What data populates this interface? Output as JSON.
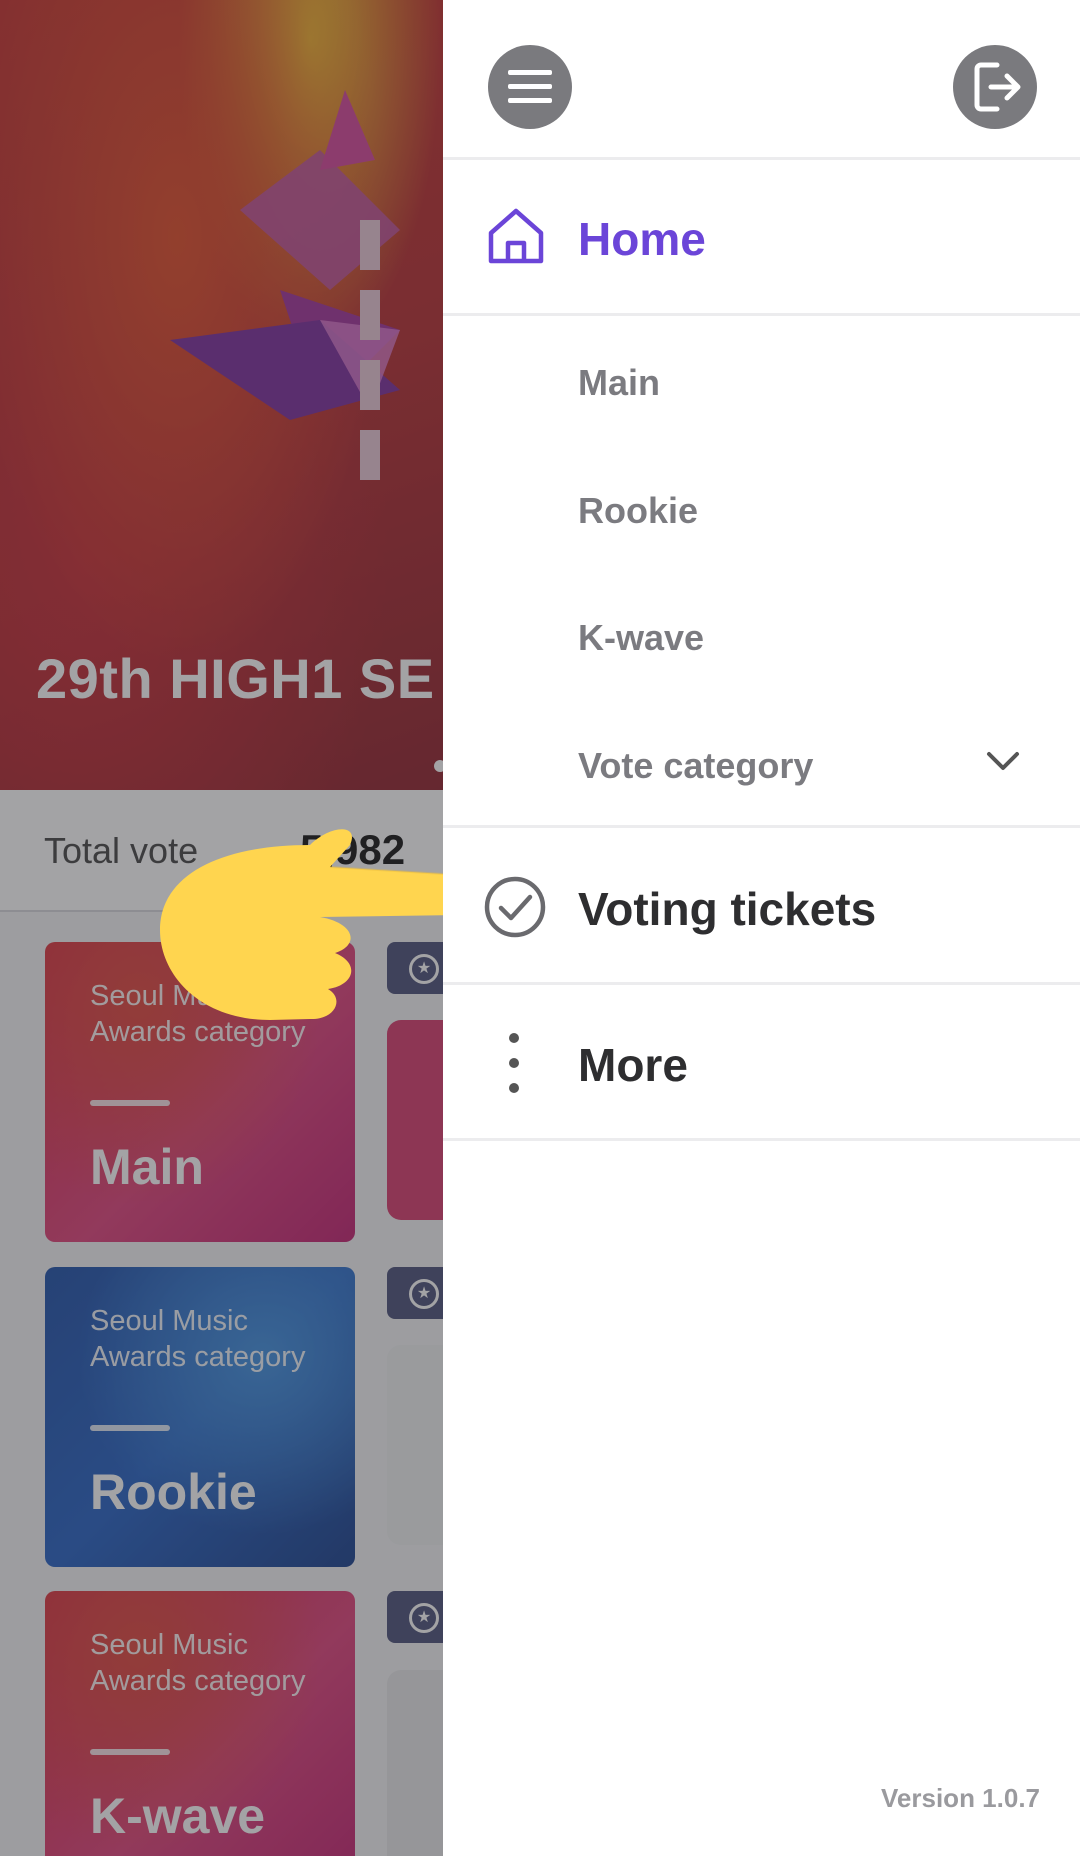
{
  "background": {
    "hero_title": "29th HIGH1 SE",
    "total_votes_label": "Total vote",
    "total_votes_value": "5,982",
    "cards": [
      {
        "subtitle": "Seoul Music Awards category",
        "name": "Main"
      },
      {
        "subtitle": "Seoul Music Awards category",
        "name": "Rookie"
      },
      {
        "subtitle": "Seoul Music Awards category",
        "name": "K-wave"
      }
    ]
  },
  "drawer": {
    "menu_icon": "hamburger-icon",
    "logout_icon": "logout-icon",
    "home": {
      "label": "Home",
      "icon": "home-icon"
    },
    "sub_items": [
      "Main",
      "Rookie",
      "K-wave",
      "Vote category"
    ],
    "voting": {
      "label": "Voting tickets",
      "icon": "check-circle-icon"
    },
    "more": {
      "label": "More",
      "icon": "vertical-dots-icon"
    },
    "version": "Version 1.0.7"
  },
  "colors": {
    "accent": "#6b45d8",
    "dim_overlay": "#323237",
    "icon_button": "#7a7a7e",
    "sub_item_text": "#7b7b80",
    "main_text": "#2e2e30"
  }
}
